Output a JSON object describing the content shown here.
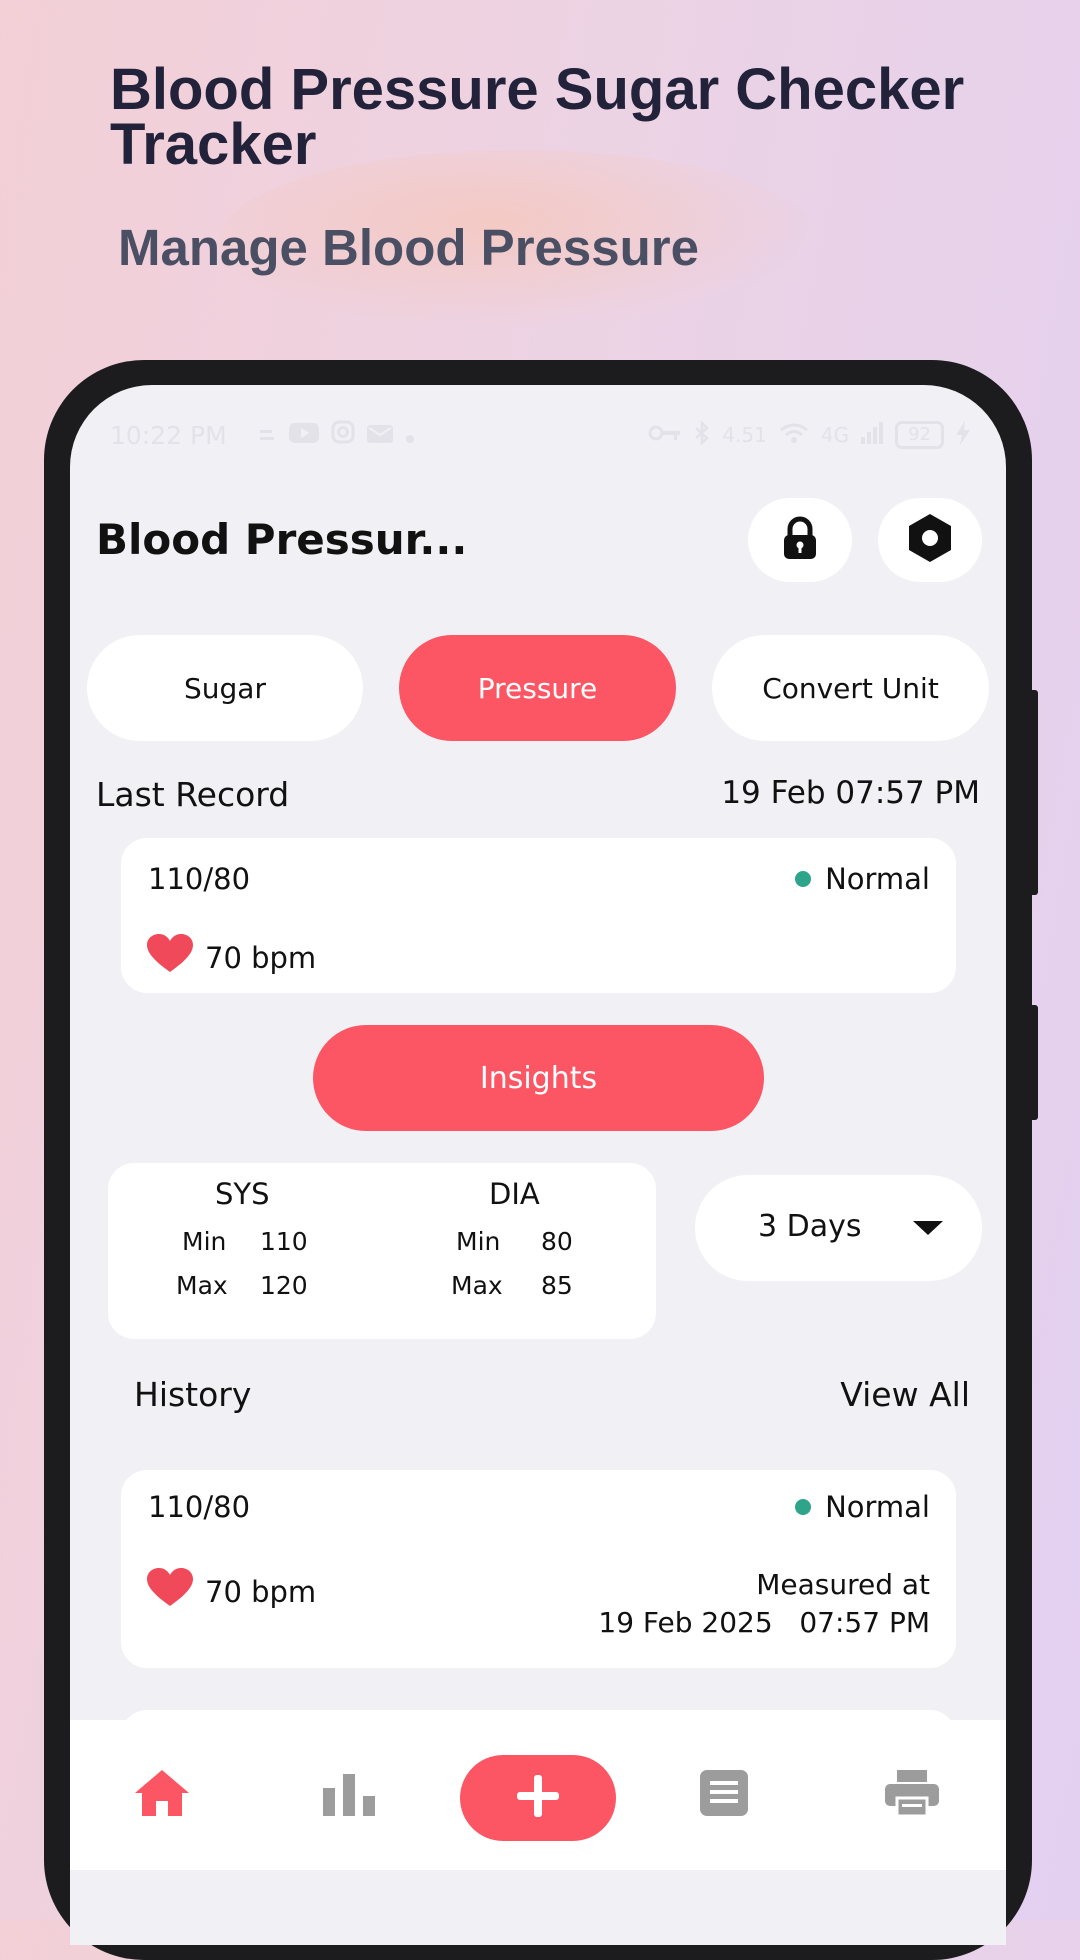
{
  "promo": {
    "title": "Blood Pressure Sugar Checker Tracker",
    "subtitle": "Manage Blood Pressure"
  },
  "status_bar": {
    "time": "10:22 PM",
    "speed": "4.51",
    "network": "4G",
    "battery": "92"
  },
  "header": {
    "title": "Blood Pressur..."
  },
  "tabs": [
    {
      "label": "Sugar",
      "active": false
    },
    {
      "label": "Pressure",
      "active": true
    },
    {
      "label": "Convert Unit",
      "active": false
    }
  ],
  "last_record": {
    "label": "Last Record",
    "datetime": "19 Feb 07:57 PM",
    "reading": "110/80",
    "status": "Normal",
    "pulse": "70 bpm"
  },
  "insights_label": "Insights",
  "stats": {
    "sys": {
      "label": "SYS",
      "min_label": "Min",
      "min": "110",
      "max_label": "Max",
      "max": "120"
    },
    "dia": {
      "label": "DIA",
      "min_label": "Min",
      "min": "80",
      "max_label": "Max",
      "max": "85"
    }
  },
  "range_select": {
    "value": "3 Days"
  },
  "history": {
    "label": "History",
    "view_all": "View All",
    "items": [
      {
        "reading": "110/80",
        "status": "Normal",
        "pulse": "70 bpm",
        "measured_label": "Measured at",
        "measured_date": "19 Feb 2025   07:57 PM"
      }
    ]
  },
  "nav": {
    "items": [
      "home-icon",
      "stats-icon",
      "add-icon",
      "list-icon",
      "print-icon"
    ]
  },
  "colors": {
    "accent": "#fc5664",
    "normal_status": "#2ea58a",
    "heart": "#f04a5a",
    "inactive_nav": "#9c9c9c"
  }
}
